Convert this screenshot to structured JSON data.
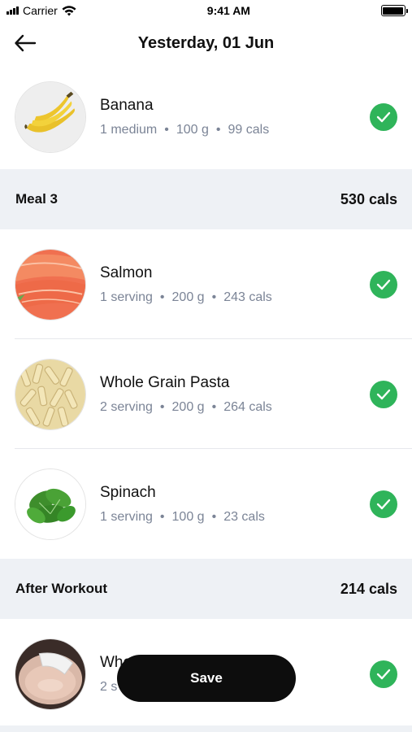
{
  "status_bar": {
    "carrier": "Carrier",
    "time": "9:41 AM"
  },
  "header": {
    "title": "Yesterday, 01 Jun"
  },
  "top_item": {
    "name": "Banana",
    "quantity": "1 medium",
    "weight": "100 g",
    "cals": "99 cals",
    "image": "banana",
    "checked": true
  },
  "meals": [
    {
      "title": "Meal 3",
      "cals": "530 cals",
      "items": [
        {
          "name": "Salmon",
          "quantity": "1 serving",
          "weight": "200 g",
          "cals": "243 cals",
          "image": "salmon",
          "checked": true
        },
        {
          "name": "Whole Grain Pasta",
          "quantity": "2 serving",
          "weight": "200 g",
          "cals": "264 cals",
          "image": "pasta",
          "checked": true
        },
        {
          "name": "Spinach",
          "quantity": "1 serving",
          "weight": "100 g",
          "cals": "23 cals",
          "image": "spinach",
          "checked": true
        }
      ]
    },
    {
      "title": "After Workout",
      "cals": "214 cals",
      "items": [
        {
          "name": "Whey Protein Isolate",
          "quantity": "2 s",
          "weight": "",
          "cals": "",
          "image": "protein-powder",
          "checked": true,
          "partially_hidden": true
        }
      ]
    }
  ],
  "save_button": {
    "label": "Save"
  },
  "colors": {
    "accent_check": "#2fb45a",
    "meal_header_bg": "#eef1f5",
    "meta_text": "#7b8496",
    "save_bg": "#0d0d0d"
  }
}
